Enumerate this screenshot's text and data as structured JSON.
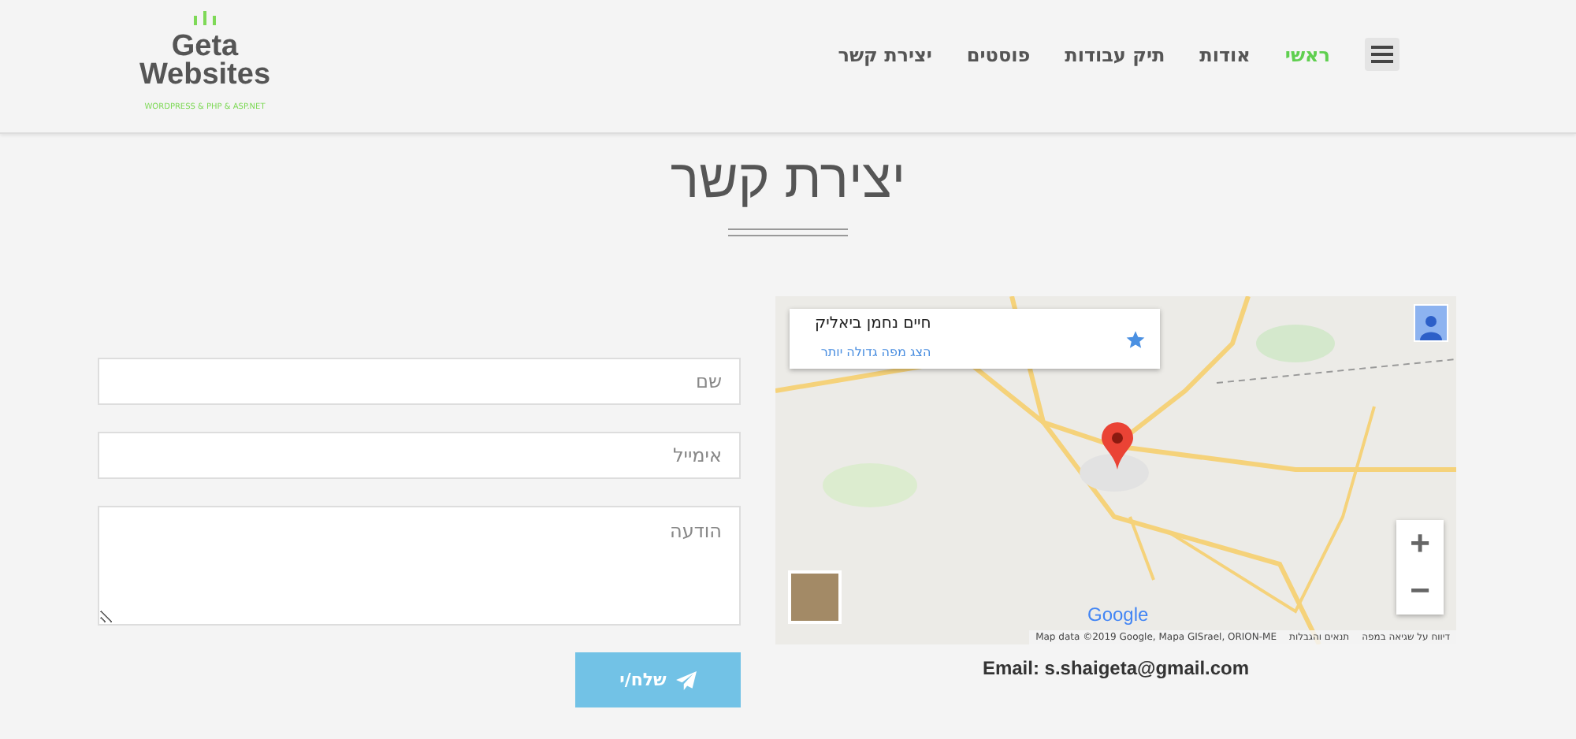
{
  "logo": {
    "name_line1": "Geta",
    "name_line2": "Websites",
    "tagline": "WORDPRESS & PHP & ASP.NET"
  },
  "nav": {
    "items": [
      {
        "label": "ראשי",
        "selected": true
      },
      {
        "label": "אודות",
        "selected": false
      },
      {
        "label": "תיק עבודות",
        "selected": false
      },
      {
        "label": "פוסטים",
        "selected": false
      },
      {
        "label": "יצירת קשר",
        "selected": false
      }
    ]
  },
  "page_title": "יצירת קשר",
  "form": {
    "fields": [
      {
        "kind": "input",
        "placeholder": "שם"
      },
      {
        "kind": "input",
        "placeholder": "אימייל"
      },
      {
        "kind": "textarea",
        "placeholder": "הודעה"
      }
    ],
    "submit": "שלח/י"
  },
  "map": {
    "place_name": "חיים נחמן ביאליק",
    "larger_map_link": "הצג מפה גדולה יותר",
    "logo": "Google",
    "attribution": "Map data ©2019 Google, Mapa GISrael, ORION-ME",
    "terms": "תנאים והגבלות",
    "report": "דיווח על שגיאה במפה",
    "zoom_in": "+",
    "zoom_out": "−"
  },
  "email": "Email: s.shaigeta@gmail.com"
}
